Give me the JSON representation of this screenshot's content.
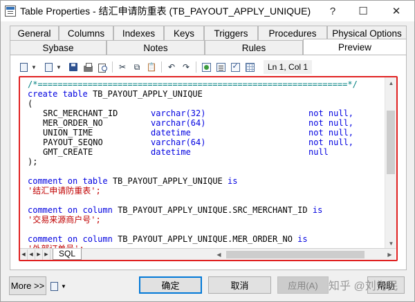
{
  "window": {
    "title": "Table Properties - 结汇申请防重表 (TB_PAYOUT_APPLY_UNIQUE)",
    "controls": {
      "help": "?",
      "maximize": "☐",
      "close": "✕"
    }
  },
  "tabs_row1": [
    "General",
    "Columns",
    "Indexes",
    "Keys",
    "Triggers",
    "Procedures",
    "Physical Options"
  ],
  "tabs_row2": [
    "Sybase",
    "Notes",
    "Rules",
    "Preview"
  ],
  "active_tab": "Preview",
  "toolbar": {
    "cursor_position": "Ln 1, Col 1"
  },
  "code": {
    "separator": "/*==============================================================*/",
    "create": {
      "keyword": "create table",
      "name": "TB_PAYOUT_APPLY_UNIQUE"
    },
    "open_paren": "(",
    "columns": [
      {
        "name": "SRC_MERCHANT_ID",
        "type": "varchar(32)",
        "nullability": "not null,"
      },
      {
        "name": "MER_ORDER_NO",
        "type": "varchar(64)",
        "nullability": "not null,"
      },
      {
        "name": "UNION_TIME",
        "type": "datetime",
        "nullability": "not null,"
      },
      {
        "name": "PAYOUT_SEQNO",
        "type": "varchar(64)",
        "nullability": "not null,"
      },
      {
        "name": "GMT_CREATE",
        "type": "datetime",
        "nullability": "null"
      }
    ],
    "close_paren": ");",
    "comments": [
      {
        "keyword": "comment on table",
        "target": "TB_PAYOUT_APPLY_UNIQUE",
        "is": "is",
        "text": "'结汇申请防重表';"
      },
      {
        "keyword": "comment on column",
        "target": "TB_PAYOUT_APPLY_UNIQUE.SRC_MERCHANT_ID",
        "is": "is",
        "text": "'交易来源商户号';"
      },
      {
        "keyword": "comment on column",
        "target": "TB_PAYOUT_APPLY_UNIQUE.MER_ORDER_NO",
        "is": "is",
        "text": "'外部订单号';"
      }
    ]
  },
  "sheet_tab": "SQL",
  "buttons": {
    "more": "More >>",
    "ok": "确定",
    "cancel": "取消",
    "apply": "应用(A)",
    "help": "帮助"
  },
  "watermark": "知乎 @刘为民"
}
